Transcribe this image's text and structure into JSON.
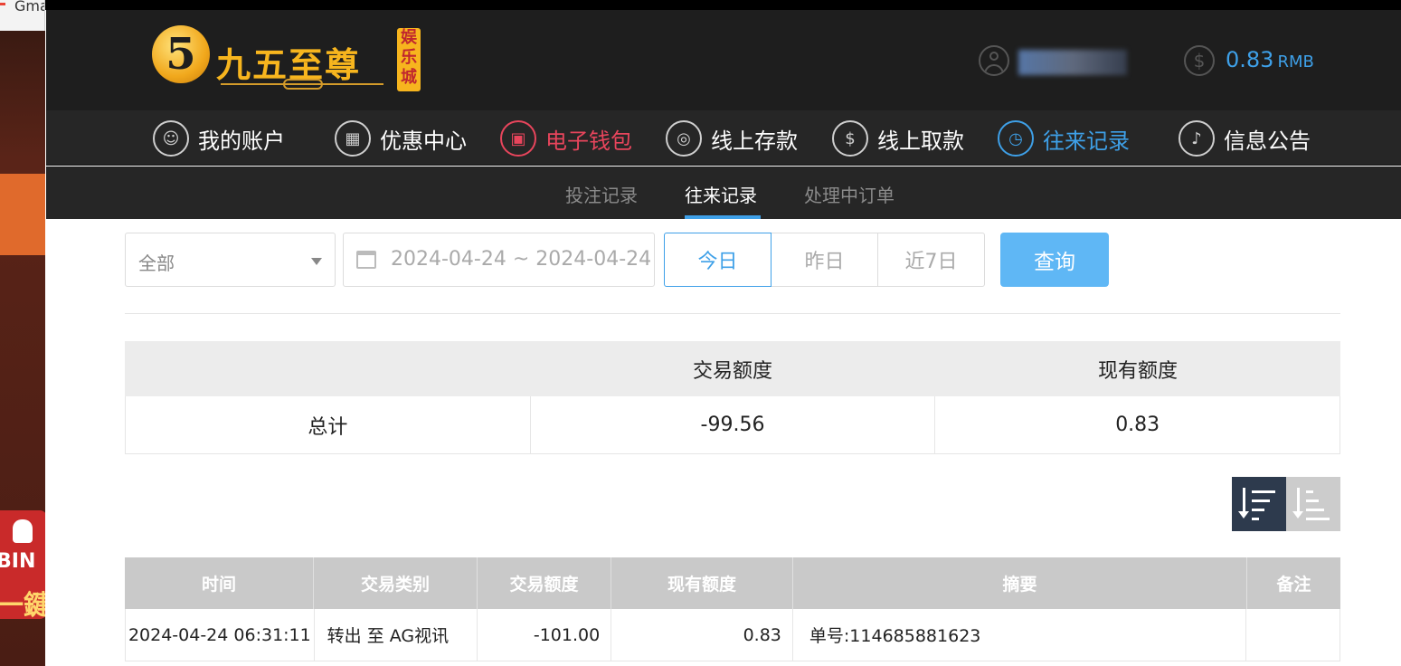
{
  "browser": {
    "tab_text": "Gma"
  },
  "promo": {
    "line1": "BIN",
    "line2": "一鍵"
  },
  "header": {
    "logo_digit": "5",
    "logo_text": "九五至尊",
    "logo_sub": [
      "娱",
      "乐",
      "城"
    ],
    "balance": "0.83",
    "currency": "RMB"
  },
  "nav": {
    "items": [
      {
        "label": "我的账户",
        "icon": "user-icon"
      },
      {
        "label": "优惠中心",
        "icon": "gift-icon"
      },
      {
        "label": "电子钱包",
        "icon": "wallet-icon"
      },
      {
        "label": "线上存款",
        "icon": "deposit-icon"
      },
      {
        "label": "线上取款",
        "icon": "withdraw-icon"
      },
      {
        "label": "往来记录",
        "icon": "records-icon"
      },
      {
        "label": "信息公告",
        "icon": "bell-icon"
      }
    ]
  },
  "subnav": {
    "items": [
      "投注记录",
      "往来记录",
      "处理中订单"
    ]
  },
  "filters": {
    "type_value": "全部",
    "date_range": "2024-04-24 ~ 2024-04-24",
    "days": [
      "今日",
      "昨日",
      "近7日"
    ],
    "query_label": "查询"
  },
  "summary": {
    "headers": [
      "",
      "交易额度",
      "现有额度"
    ],
    "row": [
      "总计",
      "-99.56",
      "0.83"
    ]
  },
  "records": {
    "headers": [
      "时间",
      "交易类别",
      "交易额度",
      "现有额度",
      "摘要",
      "备注"
    ],
    "rows": [
      [
        "2024-04-24 06:31:11",
        "转出 至 AG视讯",
        "-101.00",
        "0.83",
        "单号:114685881623",
        ""
      ]
    ]
  },
  "colors": {
    "accent_blue": "#3ea0e8",
    "accent_red": "#e8455c",
    "logo_gold": "#f7b51e",
    "header_bg": "#1e1e1e"
  }
}
